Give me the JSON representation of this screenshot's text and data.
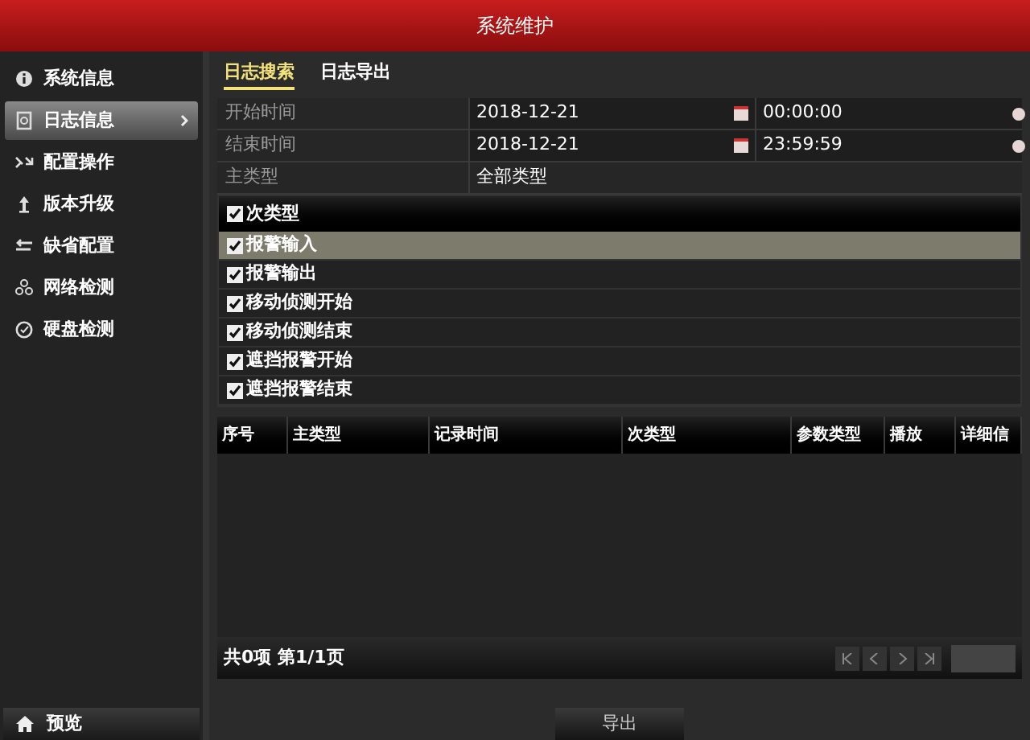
{
  "window": {
    "title": "系统维护"
  },
  "sidebar": {
    "items": [
      {
        "label": "系统信息",
        "selected": false
      },
      {
        "label": "日志信息",
        "selected": true
      },
      {
        "label": "配置操作",
        "selected": false
      },
      {
        "label": "版本升级",
        "selected": false
      },
      {
        "label": "缺省配置",
        "selected": false
      },
      {
        "label": "网络检测",
        "selected": false
      },
      {
        "label": "硬盘检测",
        "selected": false
      }
    ],
    "bottom_button": "预览"
  },
  "tabs": [
    {
      "label": "日志搜索",
      "selected": true
    },
    {
      "label": "日志导出",
      "selected": false
    }
  ],
  "form": [
    {
      "kind": "datetime",
      "label": "开始时间",
      "date": "2018-12-21",
      "time": "00:00:00"
    },
    {
      "kind": "datetime",
      "label": "结束时间",
      "date": "2018-12-21",
      "time": "23:59:59"
    },
    {
      "kind": "select",
      "label": "主类型",
      "value": "全部类型"
    }
  ],
  "subtypes": {
    "header": {
      "label": "次类型",
      "checked": true
    },
    "items": [
      {
        "label": "报警输入",
        "checked": true,
        "selected": true
      },
      {
        "label": "报警输出",
        "checked": true,
        "selected": false
      },
      {
        "label": "移动侦测开始",
        "checked": true,
        "selected": false
      },
      {
        "label": "移动侦测结束",
        "checked": true,
        "selected": false
      },
      {
        "label": "遮挡报警开始",
        "checked": true,
        "selected": false
      },
      {
        "label": "遮挡报警结束",
        "checked": true,
        "selected": false
      }
    ]
  },
  "table": {
    "columns": [
      "序号",
      "主类型",
      "记录时间",
      "次类型",
      "参数类型",
      "播放",
      "详细信"
    ]
  },
  "footer": {
    "summary": "共0项 第1/1页"
  },
  "buttons": [
    "导出"
  ]
}
